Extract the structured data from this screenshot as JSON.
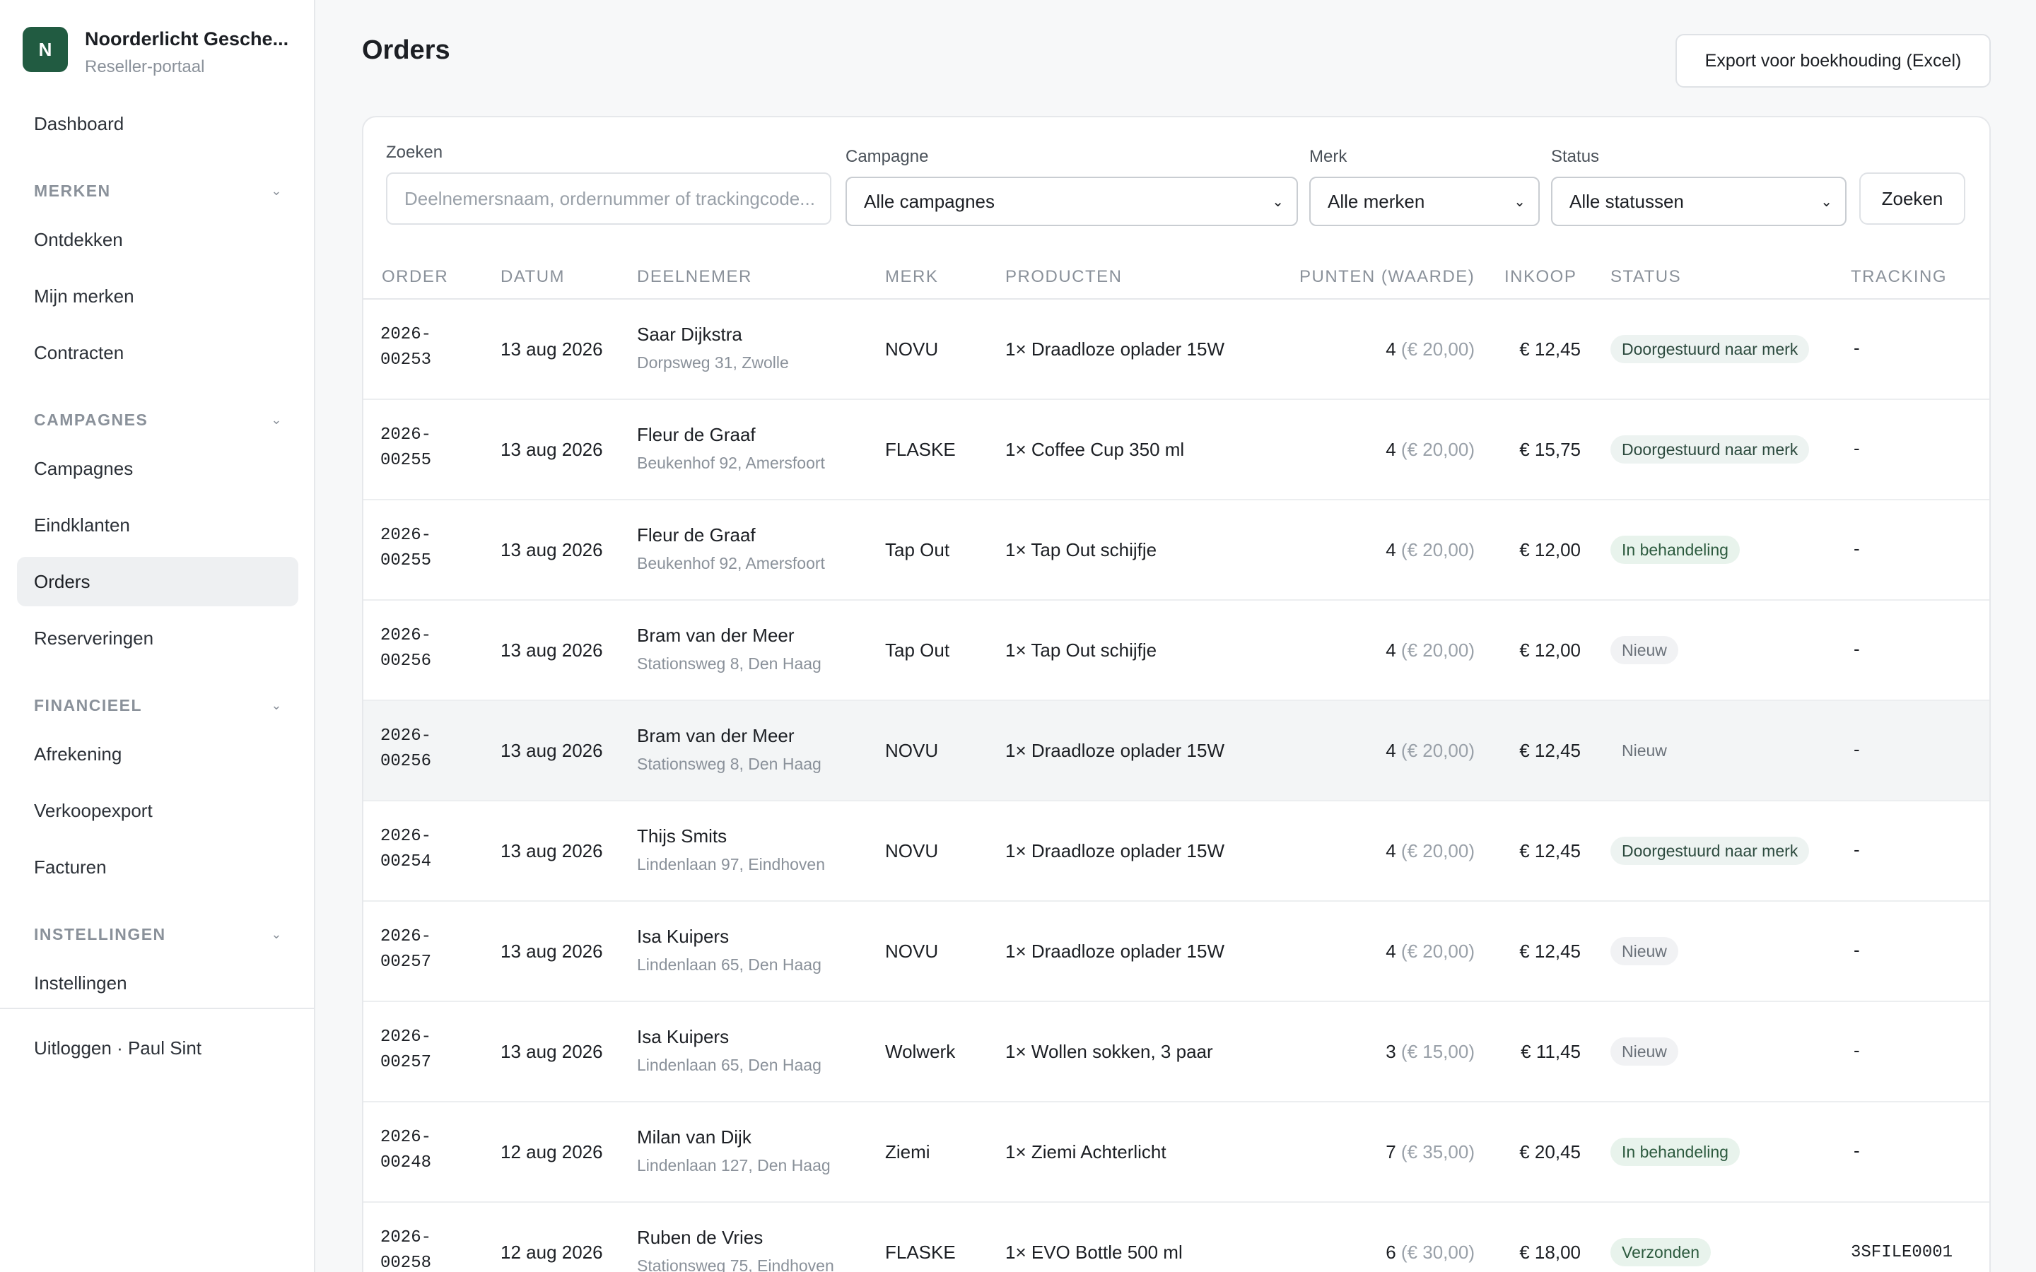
{
  "brand": {
    "logo_letter": "N",
    "name": "Noorderlicht Gesche...",
    "subtitle": "Reseller-portaal"
  },
  "sidebar": {
    "dashboard": "Dashboard",
    "sections": [
      {
        "title": "MERKEN",
        "items": [
          "Ontdekken",
          "Mijn merken",
          "Contracten"
        ]
      },
      {
        "title": "CAMPAGNES",
        "items": [
          "Campagnes",
          "Eindklanten",
          "Orders",
          "Reserveringen"
        ]
      },
      {
        "title": "FINANCIEEL",
        "items": [
          "Afrekening",
          "Verkoopexport",
          "Facturen"
        ]
      },
      {
        "title": "INSTELLINGEN",
        "items": [
          "Instellingen"
        ]
      }
    ],
    "active_item": "Orders",
    "logout": "Uitloggen · Paul Sint"
  },
  "page": {
    "title": "Orders",
    "export_label": "Export voor boekhouding (Excel)"
  },
  "filters": {
    "search_label": "Zoeken",
    "search_placeholder": "Deelnemersnaam, ordernummer of trackingcode...",
    "campaign_label": "Campagne",
    "campaign_value": "Alle campagnes",
    "brand_label": "Merk",
    "brand_value": "Alle merken",
    "status_label": "Status",
    "status_value": "Alle statussen",
    "search_button": "Zoeken"
  },
  "table": {
    "headers": [
      "ORDER",
      "DATUM",
      "DEELNEMER",
      "MERK",
      "PRODUCTEN",
      "PUNTEN (WAARDE)",
      "INKOOP",
      "STATUS",
      "TRACKING"
    ],
    "rows": [
      {
        "order_a": "2026-",
        "order_b": "00253",
        "date": "13 aug 2026",
        "name": "Saar Dijkstra",
        "address": "Dorpsweg 31, Zwolle",
        "brand": "NOVU",
        "product": "1× Draadloze oplader 15W",
        "points": "4",
        "value": "(€ 20,00)",
        "cost": "€ 12,45",
        "status": "Doorgestuurd naar merk",
        "status_kind": "forwarded",
        "tracking": "-"
      },
      {
        "order_a": "2026-",
        "order_b": "00255",
        "date": "13 aug 2026",
        "name": "Fleur de Graaf",
        "address": "Beukenhof 92, Amersfoort",
        "brand": "FLASKE",
        "product": "1× Coffee Cup 350 ml",
        "points": "4",
        "value": "(€ 20,00)",
        "cost": "€ 15,75",
        "status": "Doorgestuurd naar merk",
        "status_kind": "forwarded",
        "tracking": "-"
      },
      {
        "order_a": "2026-",
        "order_b": "00255",
        "date": "13 aug 2026",
        "name": "Fleur de Graaf",
        "address": "Beukenhof 92, Amersfoort",
        "brand": "Tap Out",
        "product": "1× Tap Out schijfje",
        "points": "4",
        "value": "(€ 20,00)",
        "cost": "€ 12,00",
        "status": "In behandeling",
        "status_kind": "processing",
        "tracking": "-"
      },
      {
        "order_a": "2026-",
        "order_b": "00256",
        "date": "13 aug 2026",
        "name": "Bram van der Meer",
        "address": "Stationsweg 8, Den Haag",
        "brand": "Tap Out",
        "product": "1× Tap Out schijfje",
        "points": "4",
        "value": "(€ 20,00)",
        "cost": "€ 12,00",
        "status": "Nieuw",
        "status_kind": "new",
        "tracking": "-"
      },
      {
        "order_a": "2026-",
        "order_b": "00256",
        "date": "13 aug 2026",
        "name": "Bram van der Meer",
        "address": "Stationsweg 8, Den Haag",
        "brand": "NOVU",
        "product": "1× Draadloze oplader 15W",
        "points": "4",
        "value": "(€ 20,00)",
        "cost": "€ 12,45",
        "status": "Nieuw",
        "status_kind": "new",
        "tracking": "-"
      },
      {
        "order_a": "2026-",
        "order_b": "00254",
        "date": "13 aug 2026",
        "name": "Thijs Smits",
        "address": "Lindenlaan 97, Eindhoven",
        "brand": "NOVU",
        "product": "1× Draadloze oplader 15W",
        "points": "4",
        "value": "(€ 20,00)",
        "cost": "€ 12,45",
        "status": "Doorgestuurd naar merk",
        "status_kind": "forwarded",
        "tracking": "-"
      },
      {
        "order_a": "2026-",
        "order_b": "00257",
        "date": "13 aug 2026",
        "name": "Isa Kuipers",
        "address": "Lindenlaan 65, Den Haag",
        "brand": "NOVU",
        "product": "1× Draadloze oplader 15W",
        "points": "4",
        "value": "(€ 20,00)",
        "cost": "€ 12,45",
        "status": "Nieuw",
        "status_kind": "new",
        "tracking": "-"
      },
      {
        "order_a": "2026-",
        "order_b": "00257",
        "date": "13 aug 2026",
        "name": "Isa Kuipers",
        "address": "Lindenlaan 65, Den Haag",
        "brand": "Wolwerk",
        "product": "1× Wollen sokken, 3 paar",
        "points": "3",
        "value": "(€ 15,00)",
        "cost": "€ 11,45",
        "status": "Nieuw",
        "status_kind": "new",
        "tracking": "-"
      },
      {
        "order_a": "2026-",
        "order_b": "00248",
        "date": "12 aug 2026",
        "name": "Milan van Dijk",
        "address": "Lindenlaan 127, Den Haag",
        "brand": "Ziemi",
        "product": "1× Ziemi Achterlicht",
        "points": "7",
        "value": "(€ 35,00)",
        "cost": "€ 20,45",
        "status": "In behandeling",
        "status_kind": "processing",
        "tracking": "-"
      },
      {
        "order_a": "2026-",
        "order_b": "00258",
        "date": "12 aug 2026",
        "name": "Ruben de Vries",
        "address": "Stationsweg 75, Eindhoven",
        "brand": "FLASKE",
        "product": "1× EVO Bottle 500 ml",
        "points": "6",
        "value": "(€ 30,00)",
        "cost": "€ 18,00",
        "status": "Verzonden",
        "status_kind": "shipped",
        "tracking": "3SFILE0001"
      }
    ]
  },
  "colors": {
    "brand_green": "#215b41",
    "badge_forwarded_bg": "#edf3f1",
    "badge_forwarded_fg": "#2c4a3e",
    "badge_processing_bg": "#e8f3ec",
    "badge_processing_fg": "#2c5a3e",
    "badge_new_bg": "#f1f2f4",
    "badge_new_fg": "#6b727a",
    "badge_shipped_bg": "#e8f3ec",
    "badge_shipped_fg": "#2c5a3e"
  }
}
